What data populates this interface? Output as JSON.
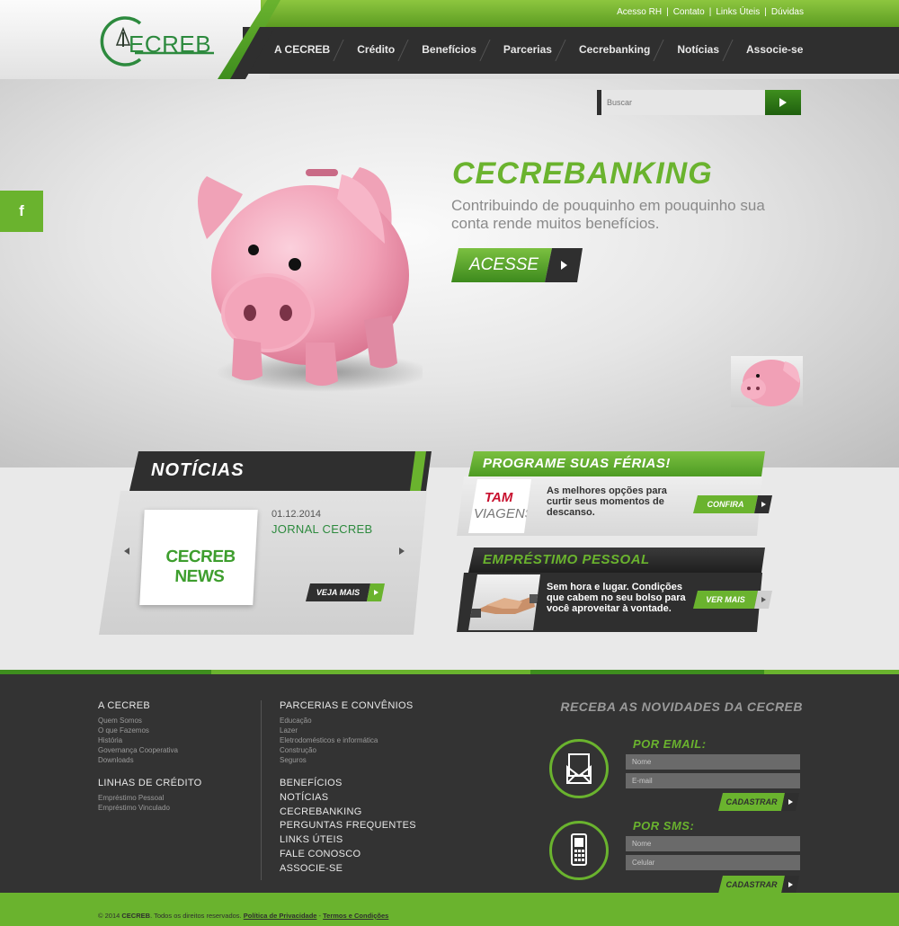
{
  "brand": {
    "logo_text": "ECREB"
  },
  "toplinks": [
    "Acesso RH",
    "Contato",
    "Links Úteis",
    "Dúvidas"
  ],
  "nav": [
    "A CECREB",
    "Crédito",
    "Benefícios",
    "Parcerias",
    "Cecrebanking",
    "Notícias",
    "Associe-se"
  ],
  "search": {
    "placeholder": "Buscar"
  },
  "social": {
    "facebook": "f"
  },
  "hero": {
    "title": "CECREBANKING",
    "subtitle": "Contribuindo de pouquinho em pouquinho sua conta rende muitos benefícios.",
    "button": "ACESSE"
  },
  "noticias": {
    "title": "NOTÍCIAS",
    "image_text": "CECREB NEWS",
    "date": "01.12.2014",
    "headline": "JORNAL CECREB",
    "button": "VEJA MAIS"
  },
  "ferias": {
    "title": "PROGRAME SUAS FÉRIAS!",
    "logo_line1": "TAM",
    "logo_line2": "VIAGENS",
    "text": "As melhores opções para curtir seus momentos de descanso.",
    "button": "CONFIRA"
  },
  "emprestimo": {
    "title": "EMPRÉSTIMO PESSOAL",
    "text": "Sem hora e lugar. Condições que cabem no seu bolso para você aproveitar à vontade.",
    "button": "VER MAIS"
  },
  "footer": {
    "col1": {
      "head1": "A CECREB",
      "links1": [
        "Quem Somos",
        "O que Fazemos",
        "História",
        "Governança Cooperativa",
        "Downloads"
      ],
      "head2": "LINHAS DE CRÉDITO",
      "links2": [
        "Empréstimo Pessoal",
        "Empréstimo Vinculado"
      ]
    },
    "col2": {
      "head": "PARCERIAS E CONVÊNIOS",
      "links": [
        "Educação",
        "Lazer",
        "Eletrodomésticos e informática",
        "Construção",
        "Seguros"
      ],
      "main_links": [
        "BENEFÍCIOS",
        "NOTÍCIAS",
        "CECREBANKING",
        "PERGUNTAS FREQUENTES",
        "LINKS ÚTEIS",
        "FALE CONOSCO",
        "ASSOCIE-SE"
      ]
    },
    "newsletter": {
      "title": "RECEBA AS NOVIDADES DA CECREB",
      "email_label": "POR EMAIL:",
      "email_name_placeholder": "Nome",
      "email_placeholder": "E-mail",
      "sms_label": "POR SMS:",
      "sms_name_placeholder": "Nome",
      "sms_phone_placeholder": "Celular",
      "submit": "CADASTRAR"
    },
    "copyright_prefix": "© 2014",
    "copyright_brand": "CECREB",
    "copyright_rest": ". Todos os direitos reservados.",
    "privacy": "Política de Privacidade",
    "terms": "Termos e Condições"
  },
  "colors": {
    "green": "#6ab32e",
    "dark_green": "#3e8e1e",
    "dark": "#2f2f2f",
    "pig_pink": "#f4a3b9"
  }
}
